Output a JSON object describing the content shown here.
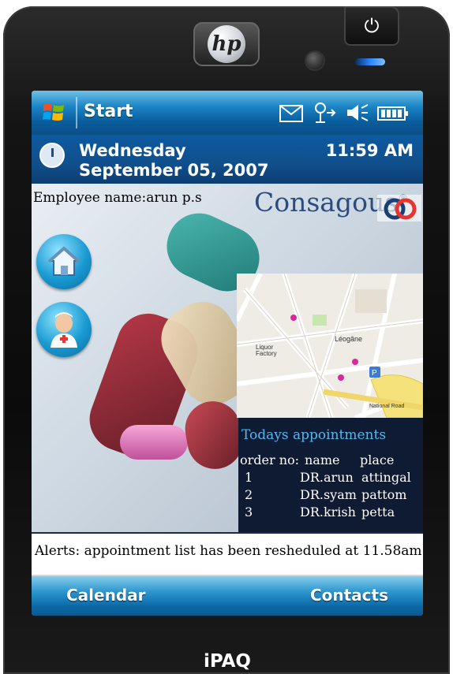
{
  "device": {
    "brand": "hp",
    "model": "iPAQ"
  },
  "statusbar": {
    "start_label": "Start"
  },
  "datebar": {
    "day": "Wednesday",
    "date": "September 05, 2007",
    "time": "11:59 AM"
  },
  "header": {
    "employee_label": "Employee name:arun p.s",
    "brand_name": "Consagous",
    "registered_mark": "®"
  },
  "appointments": {
    "title": "Todays appointments",
    "columns": [
      "order no:",
      "name",
      "place"
    ],
    "rows": [
      {
        "order": "1",
        "name": "DR.arun",
        "place": "attingal"
      },
      {
        "order": "2",
        "name": "DR.syam",
        "place": "pattom"
      },
      {
        "order": "3",
        "name": "DR.krish",
        "place": "petta"
      }
    ]
  },
  "alerts": {
    "text": "Alerts: appointment  list has been resheduled at 11.58am"
  },
  "softkeys": {
    "left": "Calendar",
    "right": "Contacts"
  },
  "colors": {
    "accent": "#1c86c6",
    "appt_title": "#53b7f2",
    "appt_bg": "#0f1a33"
  }
}
